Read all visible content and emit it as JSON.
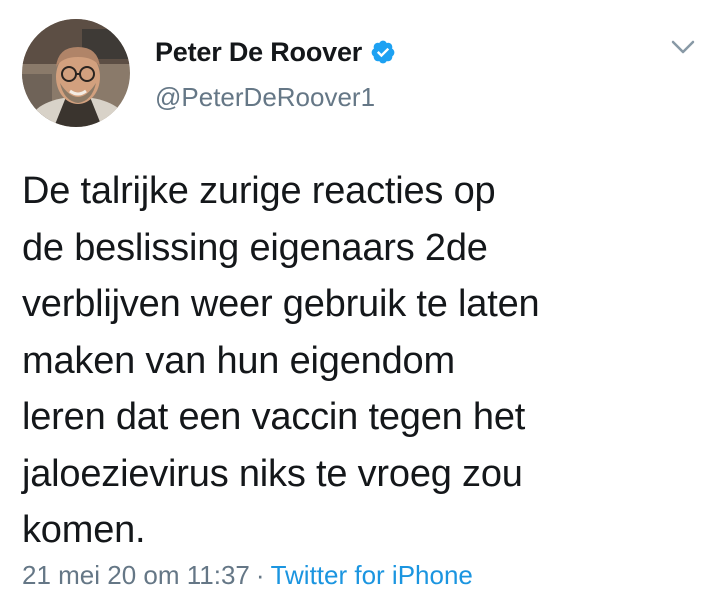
{
  "author": {
    "display_name": "Peter De Roover",
    "handle": "@PeterDeRoover1",
    "verified": true,
    "avatar_icon": "profile-photo"
  },
  "tweet": {
    "text": "De talrijke zurige reacties op\nde beslissing eigenaars 2de\nverblijven weer gebruik te laten\nmaken van hun eigendom\nleren dat een vaccin tegen het\njaloezievirus niks te vroeg zou\nkomen."
  },
  "meta": {
    "timestamp": "21 mei 20 om 11:37",
    "separator": "·",
    "source": "Twitter for iPhone"
  },
  "icons": {
    "verified": "verified-badge-icon",
    "menu": "chevron-down-icon"
  },
  "colors": {
    "text": "#14171a",
    "secondary": "#657786",
    "link": "#1b95e0",
    "verified": "#1da1f2"
  }
}
